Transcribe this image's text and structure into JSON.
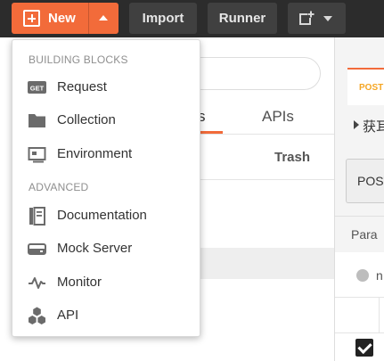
{
  "toolbar": {
    "new_label": "New",
    "import_label": "Import",
    "runner_label": "Runner"
  },
  "menu": {
    "sections": [
      {
        "header": "BUILDING BLOCKS",
        "items": [
          {
            "label": "Request",
            "icon": "get-request-icon",
            "badge": "GET"
          },
          {
            "label": "Collection",
            "icon": "folder-icon"
          },
          {
            "label": "Environment",
            "icon": "environment-icon"
          }
        ]
      },
      {
        "header": "ADVANCED",
        "items": [
          {
            "label": "Documentation",
            "icon": "documentation-icon"
          },
          {
            "label": "Mock Server",
            "icon": "mock-server-icon"
          },
          {
            "label": "Monitor",
            "icon": "monitor-pulse-icon"
          },
          {
            "label": "API",
            "icon": "api-hexagons-icon"
          }
        ]
      }
    ]
  },
  "sidebar": {
    "tabs": [
      {
        "label": "s",
        "active": true
      },
      {
        "label": "APIs",
        "active": false
      }
    ],
    "trash_label": "Trash"
  },
  "request_pane": {
    "tab_label": "POST",
    "request_name": "获耳",
    "method": "POST",
    "params_label": "Para",
    "row_text": "n"
  },
  "colors": {
    "toolbar_bg": "#2c2c2c",
    "accent": "#f26b3a",
    "button_bg": "#404040",
    "post_method": "#f5a623"
  }
}
